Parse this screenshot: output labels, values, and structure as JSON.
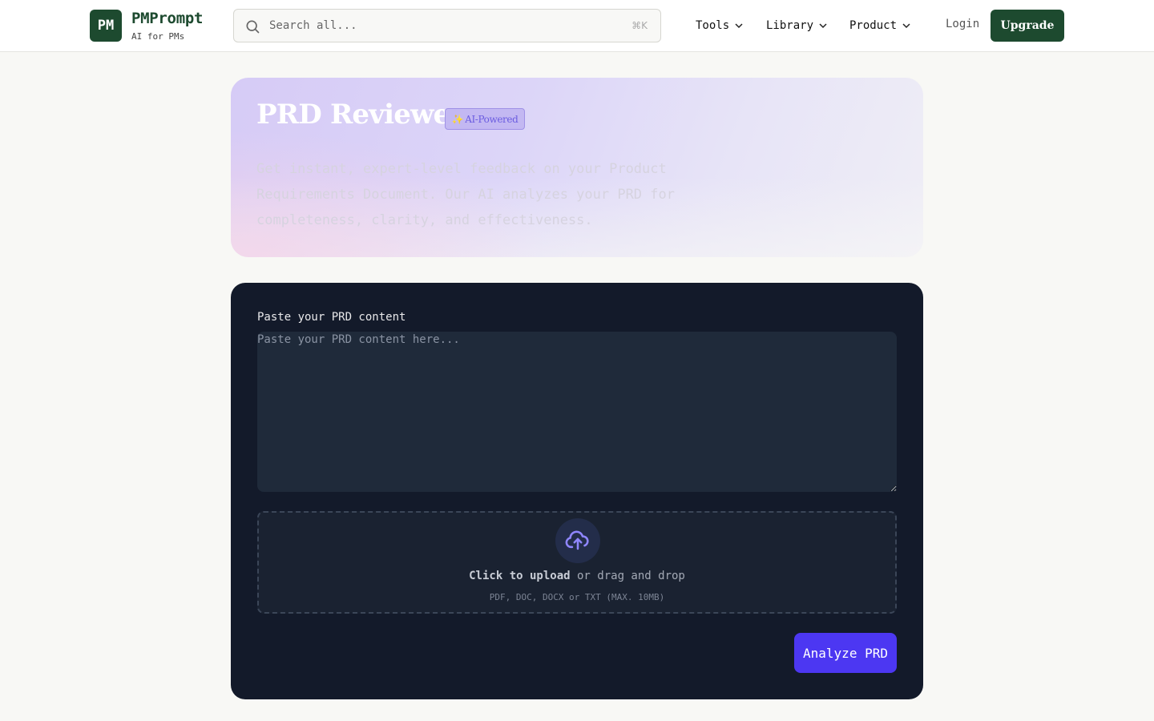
{
  "header": {
    "logo_text": "PM",
    "brand_name": "PMPrompt",
    "brand_tagline": "AI for PMs",
    "search": {
      "placeholder": "Search all...",
      "value": "",
      "shortcut": "⌘K"
    },
    "nav": [
      {
        "label": "Tools"
      },
      {
        "label": "Library"
      },
      {
        "label": "Product"
      }
    ],
    "login_label": "Login",
    "upgrade_label": "Upgrade"
  },
  "hero": {
    "title": "PRD Reviewer",
    "badge": {
      "emoji": "✨",
      "label": "AI-Powered"
    },
    "description": "Get instant, expert-level feedback on your Product Requirements Document. Our AI analyzes your PRD for completeness, clarity, and effectiveness."
  },
  "form": {
    "content_label": "Paste your PRD content",
    "content_placeholder": "Paste your PRD content here...",
    "content_value": "",
    "upload": {
      "icon": "cloud-upload-icon",
      "click_text": "Click to upload",
      "rest_text": " or drag and drop",
      "hint": "PDF, DOC, DOCX or TXT (MAX. 10MB)"
    },
    "submit_label": "Analyze PRD"
  },
  "colors": {
    "brand_green": "#1d4a2f",
    "card_bg": "#131a2a",
    "accent_purple": "#4c37f2"
  }
}
